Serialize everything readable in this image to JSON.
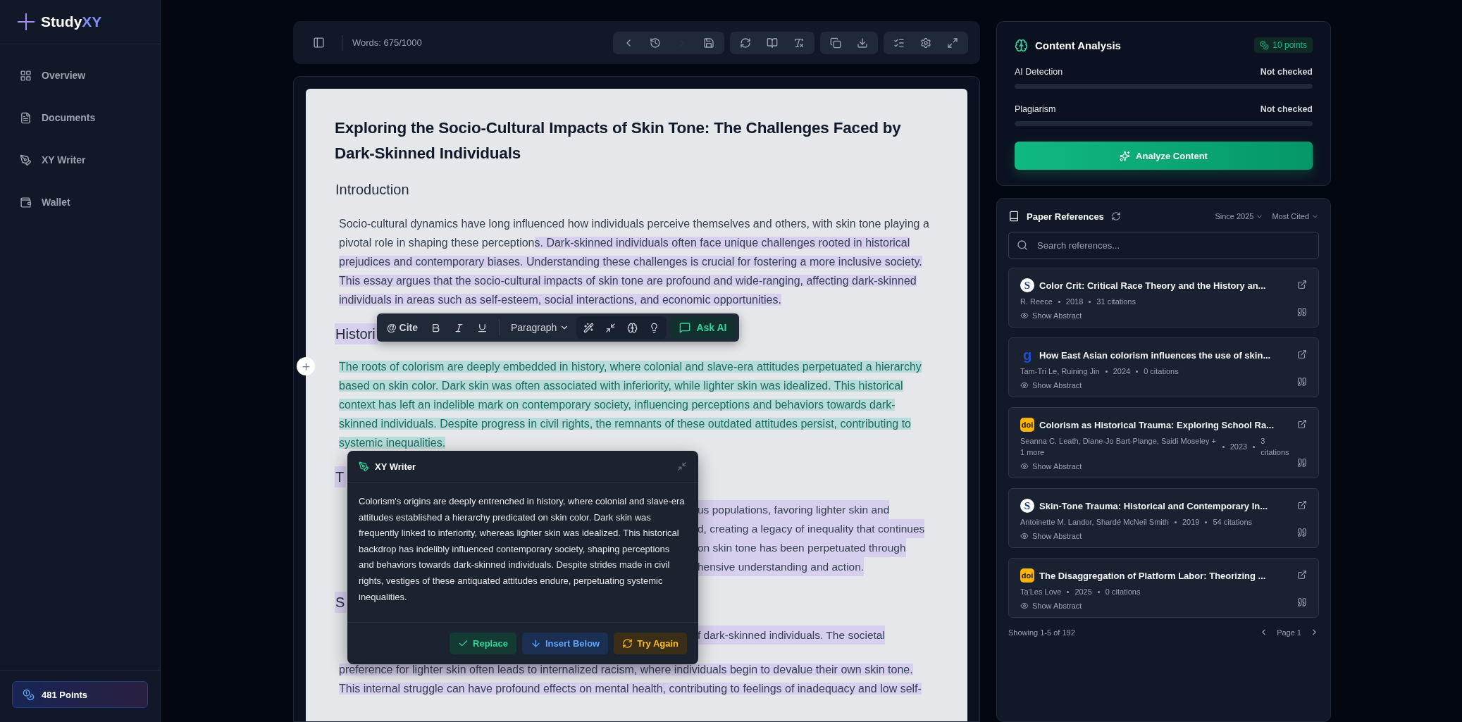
{
  "sidebar": {
    "logo": {
      "prefix": "Study",
      "accent": "XY"
    },
    "items": [
      {
        "label": "Overview",
        "selected": false
      },
      {
        "label": "Documents",
        "selected": false
      },
      {
        "label": "XY Writer",
        "selected": false
      },
      {
        "label": "Wallet",
        "selected": false
      }
    ],
    "points": "481 Points"
  },
  "toolbar": {
    "word_count": "Words: 675/1000",
    "groups": [
      [
        {
          "kind": "back",
          "disabled": false
        },
        {
          "kind": "history",
          "disabled": false
        },
        {
          "kind": "forward",
          "disabled": true
        },
        {
          "kind": "save",
          "disabled": false
        }
      ],
      [
        {
          "kind": "refresh",
          "disabled": false
        },
        {
          "kind": "book",
          "disabled": false
        },
        {
          "kind": "clear-format",
          "disabled": false
        }
      ],
      [
        {
          "kind": "copy",
          "disabled": false
        },
        {
          "kind": "download",
          "disabled": false
        }
      ],
      [
        {
          "kind": "checklist",
          "disabled": false
        },
        {
          "kind": "settings",
          "disabled": false
        },
        {
          "kind": "expand",
          "disabled": false
        }
      ]
    ]
  },
  "document": {
    "blocks": [
      {
        "kind": "title",
        "text": "Exploring the Socio-Cultural Impacts of Skin Tone: The Challenges Faced by Dark-Skinned Individuals"
      },
      {
        "kind": "heading",
        "text": "Introduction",
        "highlighted": false
      },
      {
        "kind": "paragraph",
        "segments": [
          {
            "text": "Socio-cultural dynamics have long influenced how individuals perceive themselves and others, with skin tone playing a pivotal role in shaping these perception",
            "highlighted": false,
            "selected": false
          },
          {
            "text": "s. Dark-skinned individuals often face unique challenges rooted in historical prejudices and contemporary biases. Understanding these challenges is crucial for fostering a more inclusive society. This essay argues that the socio-cultural impacts of skin tone are profound and wide-ranging, affecting dark-skinned individuals in areas such as self-esteem, social interactions, and economic opportunities.",
            "highlighted": true,
            "selected": false
          }
        ]
      },
      {
        "kind": "heading",
        "text": "Histori",
        "highlighted": true
      },
      {
        "kind": "selection",
        "segments": [
          {
            "text": "The roots of colorism are deeply embedded in history, where colonial and slave-era attitudes perpetuated a hierarchy based on skin color. Dark skin was often associated with inferiority, while lighter skin was idealized. This historical context has left an indelible mark on contemporary society, influencing perceptions and behaviors towards dark-skinned individuals. Despite progress in civil rights, the remnants of these outdated attitudes persist, contributing to systemic inequalities.",
            "selected": true
          }
        ]
      },
      {
        "kind": "heading",
        "text": "T",
        "highlighted": true
      },
      {
        "kind": "fragment",
        "lines": [
          "us populations, favoring lighter skin and",
          "d, creating a legacy of inequality that continues",
          "on skin tone has been perpetuated through",
          "hensive understanding and action."
        ]
      },
      {
        "kind": "heading",
        "text": "S",
        "highlighted": true
      },
      {
        "kind": "fragment",
        "lines": [
          "f dark-skinned individuals. The societal"
        ]
      },
      {
        "kind": "paragraph",
        "segments": [
          {
            "text": "preference for lighter skin often leads to internalized racism, where individuals begin to devalue their own skin tone. This internal struggle can have profound effects on mental health, contributing to feelings of inadequacy and low self-",
            "highlighted": true,
            "selected": false
          }
        ]
      }
    ]
  },
  "format_bar": {
    "cite": "@ Cite",
    "style": "Paragraph",
    "ask": "Ask AI"
  },
  "writer_popup": {
    "title": "XY Writer",
    "text": "Colorism's origins are deeply entrenched in history, where colonial and slave-era attitudes established a hierarchy predicated on skin color. Dark skin was frequently linked to inferiority, whereas lighter skin was idealized. This historical backdrop has indelibly influenced contemporary society, shaping perceptions and behaviors towards dark-skinned individuals. Despite strides made in civil rights, vestiges of these antiquated attitudes endure, perpetuating systemic inequalities.",
    "actions": [
      {
        "kind": "replace",
        "label": "Replace"
      },
      {
        "kind": "insert",
        "label": "Insert Below"
      },
      {
        "kind": "retry",
        "label": "Try Again"
      }
    ]
  },
  "analysis": {
    "title": "Content Analysis",
    "cost": "10 points",
    "meters": [
      {
        "label": "AI Detection",
        "status": "Not checked",
        "level": 0
      },
      {
        "label": "Plagiarism",
        "status": "Not checked",
        "level": 0
      }
    ],
    "button": "Analyze Content"
  },
  "references": {
    "title": "Paper References",
    "filters": [
      "Since 2025",
      "Most Cited"
    ],
    "search": {
      "placeholder": "Search references..."
    },
    "papers": [
      {
        "kind": "round",
        "source_label": "S",
        "title": "Color Crit: Critical Race Theory and the History an...",
        "authors": "R. Reece",
        "year": "2018",
        "citations": "31 citations",
        "abstract": "Show Abstract"
      },
      {
        "kind": "letter",
        "source_label": "g",
        "title": "How East Asian colorism influences the use of skin...",
        "authors": "Tam-Tri Le, Ruining Jin",
        "year": "2024",
        "citations": "0 citations",
        "abstract": "Show Abstract"
      },
      {
        "kind": "doi",
        "source_label": "doi",
        "title": "Colorism as Historical Trauma: Exploring School Ra...",
        "authors": "Seanna C. Leath, Diane-Jo Bart-Plange, Saidi Moseley + 1 more",
        "year": "2023",
        "citations": "3 citations",
        "abstract": "Show Abstract"
      },
      {
        "kind": "round",
        "source_label": "S",
        "title": "Skin-Tone Trauma: Historical and Contemporary In...",
        "authors": "Antoinette M. Landor, Shardé McNeil Smith",
        "year": "2019",
        "citations": "54 citations",
        "abstract": "Show Abstract"
      },
      {
        "kind": "doi",
        "source_label": "doi",
        "title": "The Disaggregation of Platform Labor: Theorizing ...",
        "authors": "Ta'Les Love",
        "year": "2025",
        "citations": "0 citations",
        "abstract": "Show Abstract"
      }
    ],
    "showing": "Showing 1-5 of 192",
    "page": "Page 1"
  }
}
